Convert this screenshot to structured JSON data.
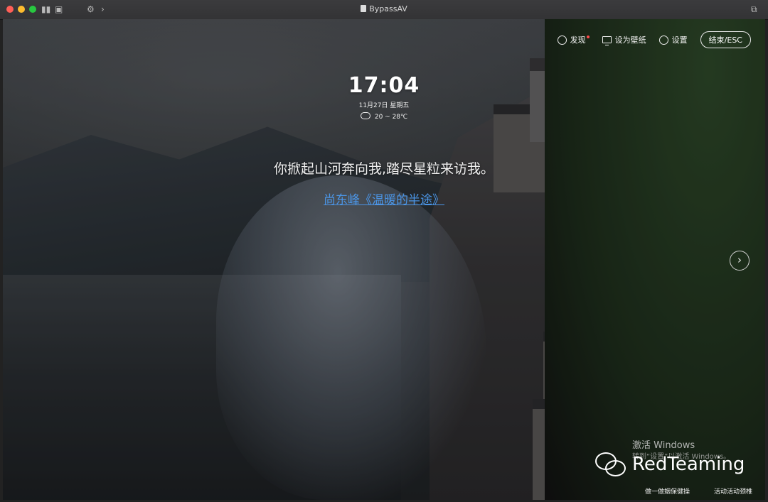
{
  "window": {
    "title": "BypassAV"
  },
  "colors": {
    "close": "#ff5f57",
    "minimize": "#febc2e",
    "zoom": "#28c840",
    "link": "#4b95e6",
    "badge": "#ff4a4a"
  },
  "toolbar": {
    "icons": [
      "sidebar-icon",
      "tabs-icon",
      "tools-icon",
      "forward-chevron-icon",
      "copy-window-icon"
    ]
  },
  "top_actions": {
    "discover": {
      "label": "发现",
      "icon": "compass-icon",
      "has_badge": true
    },
    "wallpaper": {
      "label": "设为壁纸",
      "icon": "monitor-icon"
    },
    "settings": {
      "label": "设置",
      "icon": "gear-icon"
    },
    "end": {
      "label": "结束/ESC"
    }
  },
  "clock": {
    "time": "17:04",
    "date": "11月27日 星期五"
  },
  "weather": {
    "icon": "cloud-icon",
    "range": "20 ~ 28℃"
  },
  "quote": {
    "text": "你掀起山河奔向我,踏尽星粒来访我。",
    "source": "尚东峰《温暖的半途》"
  },
  "nav": {
    "next_icon": "chevron-right-icon"
  },
  "windows_activation": {
    "line1": "激活 Windows",
    "line2": "转到“设置”以激活 Windows。"
  },
  "watermark": {
    "text": "RedTeaming",
    "icon": "wechat-icon"
  },
  "bottom_links": [
    "做一做姻保健操",
    "活动活动颈椎"
  ]
}
